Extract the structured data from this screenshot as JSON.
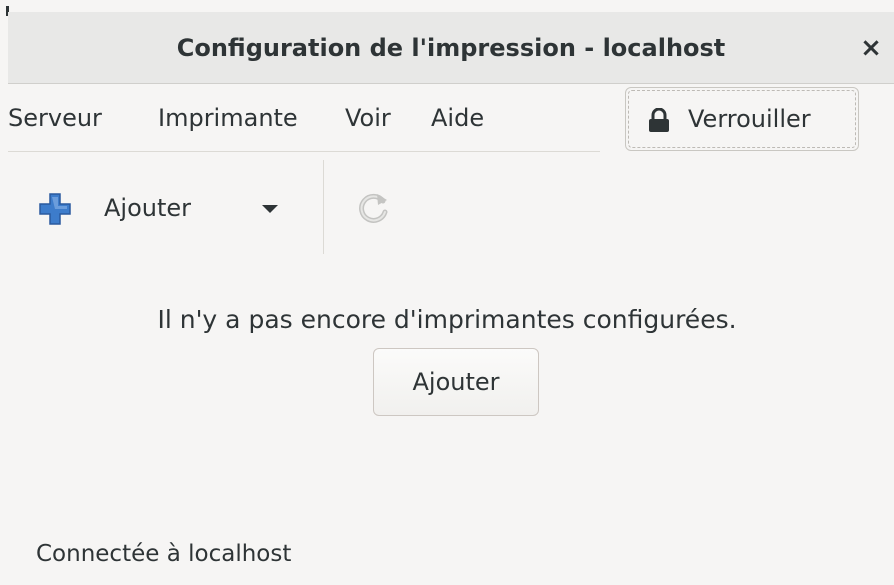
{
  "window": {
    "title": "Configuration de l'impression - localhost",
    "close_glyph": "×"
  },
  "menu": {
    "items": [
      {
        "label": "Serveur"
      },
      {
        "label": "Imprimante"
      },
      {
        "label": "Voir"
      },
      {
        "label": "Aide"
      }
    ]
  },
  "lock_button": {
    "label": "Verrouiller",
    "icon": "lock-icon"
  },
  "toolbar": {
    "add_label": "Ajouter",
    "add_icon": "plus-icon",
    "dropdown_icon": "caret-down-icon",
    "refresh_icon": "refresh-icon"
  },
  "main": {
    "empty_message": "Il n'y a pas encore d'imprimantes configurées.",
    "add_button_label": "Ajouter"
  },
  "status": {
    "text": "Connectée à localhost"
  },
  "colors": {
    "background": "#f6f5f4",
    "titlebar": "#e8e8e7",
    "text": "#2e3436",
    "plus_blue": "#3d7ccb"
  }
}
